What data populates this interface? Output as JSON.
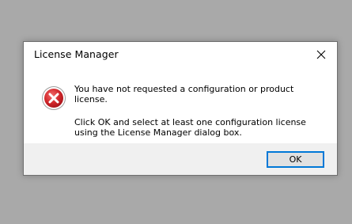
{
  "dialog": {
    "title": "License  Manager",
    "message_line1": "You have not requested a configuration or product license.",
    "message_line2a": "Click OK and select at least one configuration license",
    "message_line2b": "using the License Manager dialog box.",
    "ok_label": "OK",
    "icon": "error-icon",
    "close_icon": "close-icon"
  },
  "colors": {
    "backdrop": "#a9a9a9",
    "dialog_bg": "#ffffff",
    "footer_bg": "#f0f0f0",
    "button_bg": "#e1e1e1",
    "button_border": "#0078d7",
    "error_red": "#d32f2f"
  }
}
